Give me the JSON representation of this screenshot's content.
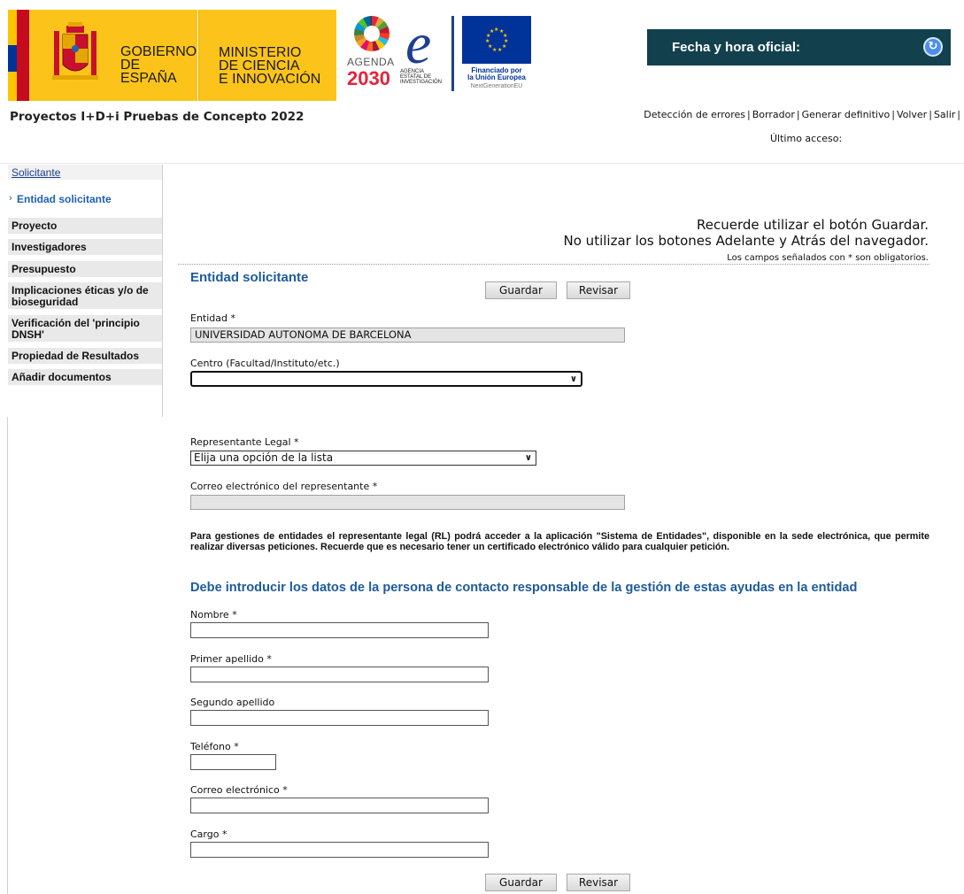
{
  "header": {
    "gobierno": [
      "GOBIERNO",
      "DE ESPAÑA"
    ],
    "ministerio": [
      "MINISTERIO",
      "DE CIENCIA",
      "E INNOVACIÓN"
    ],
    "agenda": {
      "line1": "AGENDA",
      "line2": "2030"
    },
    "aei": [
      "AGENCIA",
      "ESTATAL DE",
      "INVESTIGACIÓN"
    ],
    "eu": {
      "line1": "Financiado por",
      "line2": "la Unión Europea",
      "line3": "NextGenerationEU"
    },
    "fecha_label": "Fecha y hora oficial:"
  },
  "titlebar": {
    "app_title": "Proyectos I+D+i Pruebas de Concepto 2022",
    "links": [
      "Detección de errores",
      "Borrador",
      "Generar definitivo",
      "Volver",
      "Salir"
    ],
    "ultimo_acceso": "Último acceso:"
  },
  "sidebar": {
    "items": [
      {
        "label": "Solicitante"
      },
      {
        "label": "Entidad solicitante"
      },
      {
        "label": "Proyecto"
      },
      {
        "label": "Investigadores"
      },
      {
        "label": "Presupuesto"
      },
      {
        "label": "Implicaciones éticas y/o de bioseguridad"
      },
      {
        "label": "Verificación del 'principio DNSH'"
      },
      {
        "label": "Propiedad de Resultados"
      },
      {
        "label": "Añadir documentos"
      }
    ]
  },
  "main": {
    "notice1": "Recuerde utilizar el botón Guardar.",
    "notice2": "No utilizar los botones Adelante y Atrás del navegador.",
    "notice3": "Los campos señalados con * son obligatorios.",
    "section_title": "Entidad solicitante",
    "guardar_label": "Guardar",
    "revisar_label": "Revisar",
    "entidad_label": "Entidad *",
    "entidad_value": "UNIVERSIDAD AUTONOMA DE BARCELONA",
    "centro_label": "Centro (Facultad/Instituto/etc.)",
    "centro_value": "",
    "representante_label": "Representante Legal *",
    "representante_value": "Elija una opción de la lista",
    "correo_rep_label": "Correo electrónico del representante *",
    "correo_rep_value": "",
    "paragraph": "Para gestiones de entidades el representante legal (RL) podrá acceder a la aplicación \"Sistema de Entidades\", disponible en la sede electrónica, que permite realizar diversas peticiones. Recuerde que es necesario tener un certificado electrónico válido para cualquier petición.",
    "contact_title": "Debe introducir los datos de la persona de contacto responsable de la gestión de estas ayudas en la entidad",
    "fields": {
      "nombre": "Nombre  *",
      "primer_apellido": "Primer apellido  *",
      "segundo_apellido": "Segundo apellido",
      "telefono": "Teléfono  *",
      "correo": "Correo electrónico  *",
      "cargo": "Cargo  *"
    }
  },
  "colors": {
    "accent_blue": "#1e5b9c",
    "header_dark": "#12414d",
    "gob_yellow": "#fcc41b"
  }
}
